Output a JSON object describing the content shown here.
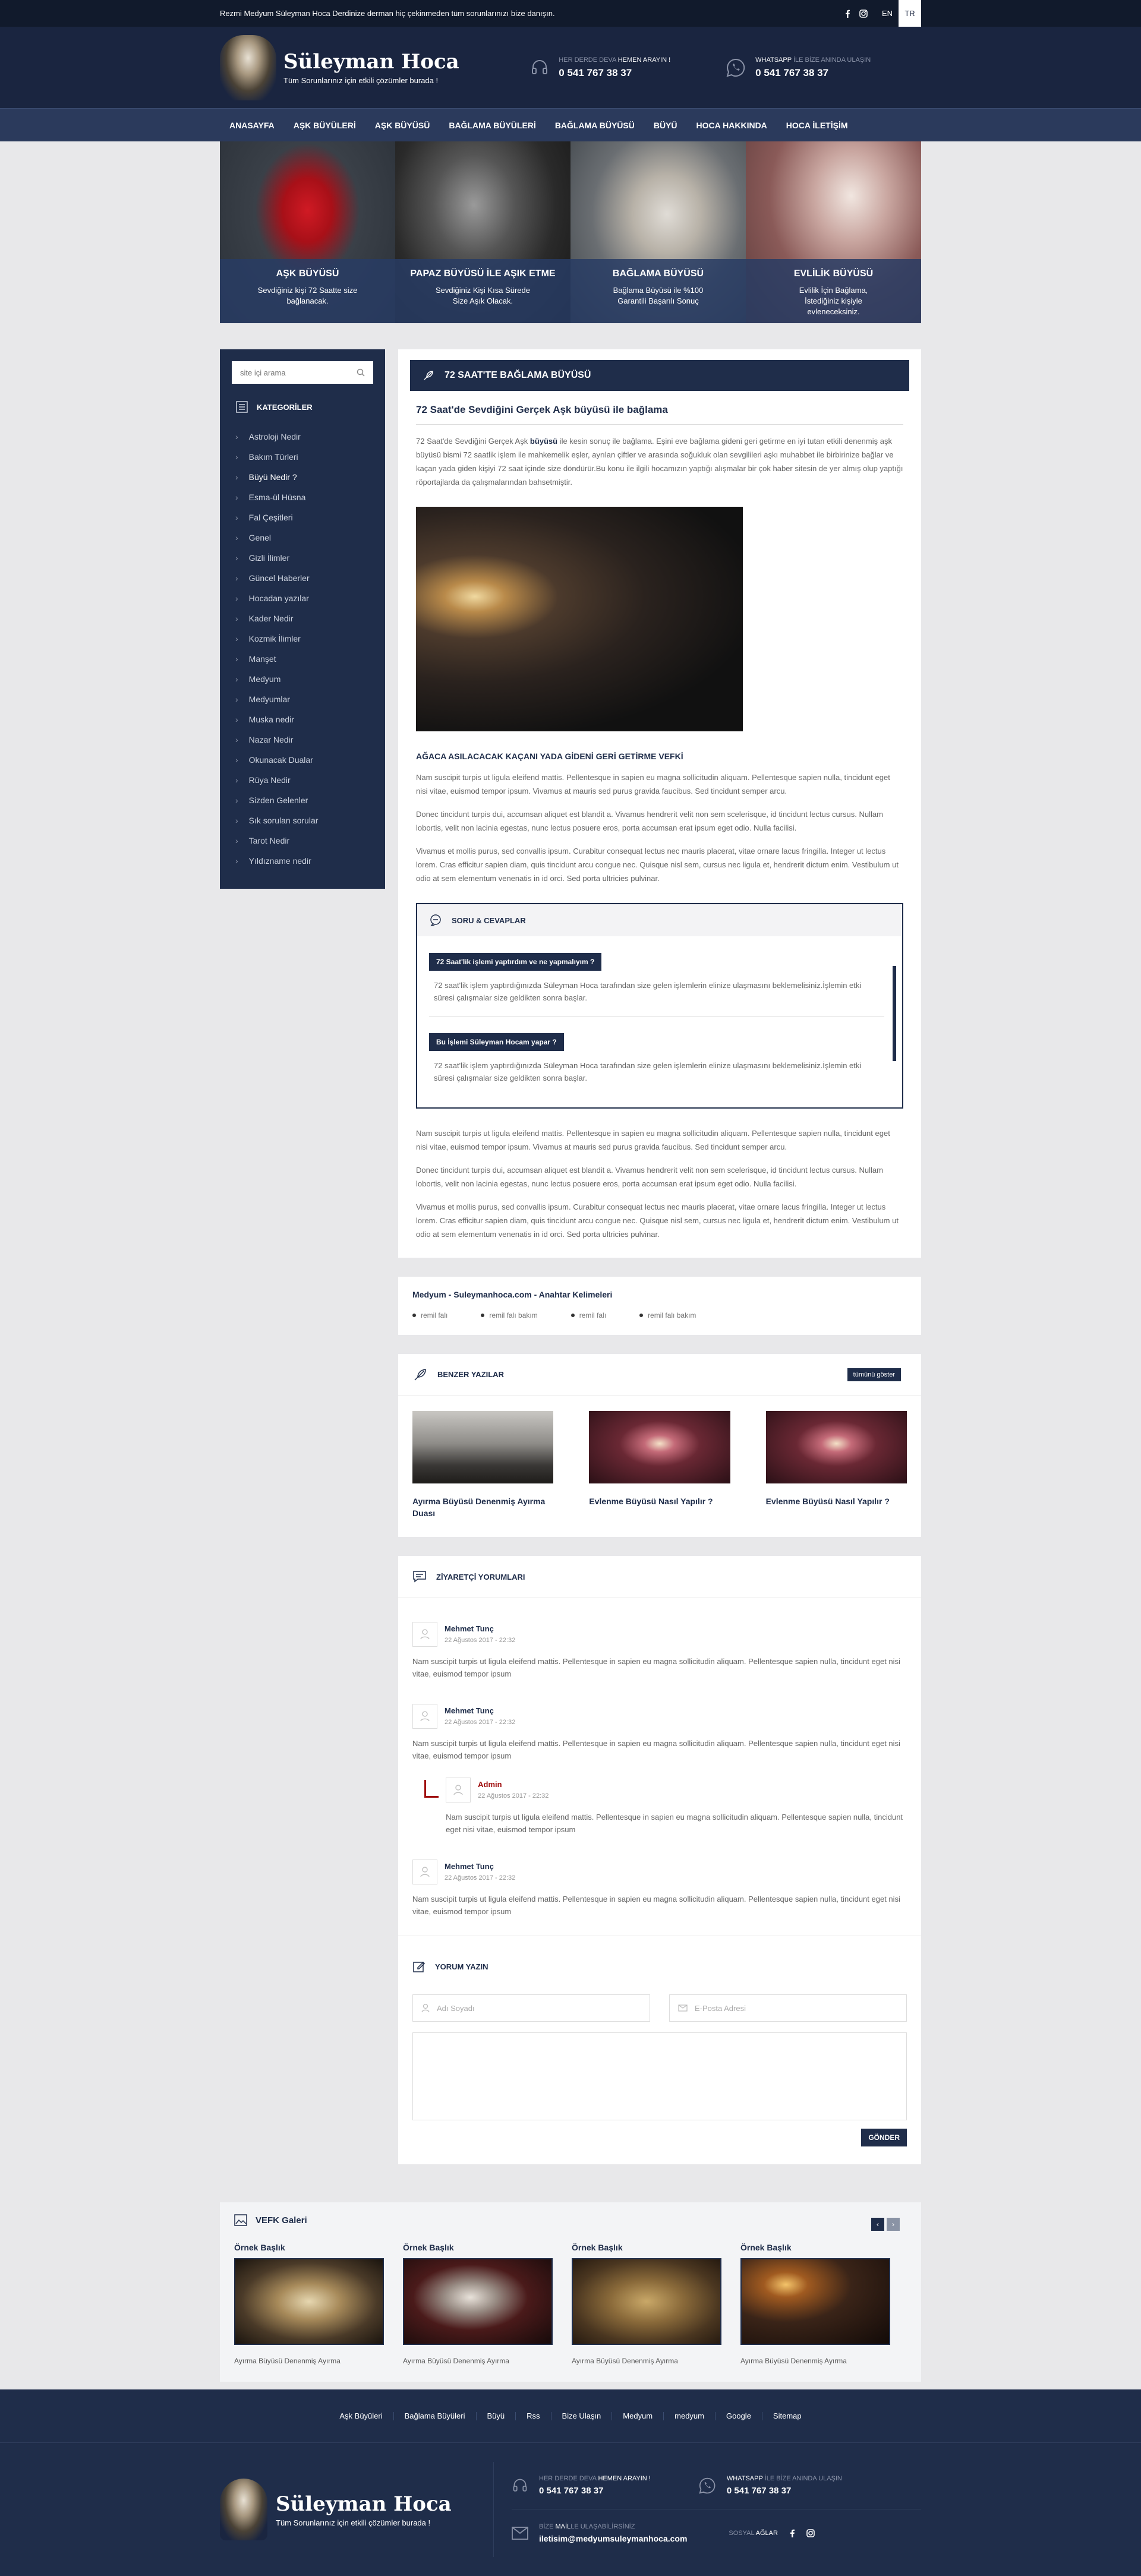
{
  "topbar": {
    "notice": "Rezmi Medyum Süleyman Hoca Derdinize derman hiç çekinmeden tüm sorunlarınızı bize danışın.",
    "lang_en": "EN",
    "lang_tr": "TR"
  },
  "header": {
    "title": "Süleyman Hoca",
    "subtitle": "Tüm Sorunlarınız için etkili çözümler burada !",
    "phone_label_a": "HER DERDE DEVA ",
    "phone_label_b": "HEMEN ARAYIN !",
    "phone": "0 541 767 38 37",
    "wa_label_a": "WHATSAPP ",
    "wa_label_b": "İLE BİZE ANINDA ULAŞIN",
    "wa_phone": "0 541 767 38 37"
  },
  "nav": [
    "ANASAYFA",
    "AŞK BÜYÜLERİ",
    "AŞK BÜYÜSÜ",
    "BAĞLAMA BÜYÜLERİ",
    "BAĞLAMA BÜYÜSÜ",
    "BÜYÜ",
    "HOCA HAKKINDA",
    "HOCA İLETİŞİM"
  ],
  "hero": [
    {
      "title": "AŞK BÜYÜSÜ",
      "text": "Sevdiğiniz kişi 72 Saatte size bağlanacak."
    },
    {
      "title": "PAPAZ BÜYÜSÜ İLE AŞIK ETME",
      "text": "Sevdiğiniz Kişi Kısa Sürede Size Aşık Olacak."
    },
    {
      "title": "BAĞLAMA BÜYÜSÜ",
      "text": "Bağlama Büyüsü ile %100 Garantili Başarılı Sonuç"
    },
    {
      "title": "EVLİLİK BÜYÜSÜ",
      "text": "Evlilik İçin Bağlama, İstediğiniz kişiyle evleneceksiniz."
    }
  ],
  "sidebar": {
    "search_placeholder": "site içi arama",
    "categories_title": "KATEGORİLER",
    "categories": [
      "Astroloji Nedir",
      "Bakım Türleri",
      "Büyü Nedir ?",
      "Esma-ül Hüsna",
      "Fal Çeşitleri",
      "Genel",
      "Gizli İlimler",
      "Güncel Haberler",
      "Hocadan yazılar",
      "Kader Nedir",
      "Kozmik İlimler",
      "Manşet",
      "Medyum",
      "Medyumlar",
      "Muska nedir",
      "Nazar Nedir",
      "Okunacak Dualar",
      "Rüya Nedir",
      "Sizden Gelenler",
      "Sık sorulan sorular",
      "Tarot Nedir",
      "Yıldızname nedir"
    ]
  },
  "post": {
    "bar_title": "72 SAAT'TE BAĞLAMA BÜYÜSÜ",
    "title": "72 Saat'de Sevdiğini Gerçek Aşk büyüsü ile bağlama",
    "p1_a": "72 Saat'de Sevdiğini Gerçek Aşk ",
    "p1_b": "büyüsü",
    "p1_c": " ile kesin sonuç ile bağlama. Eşini eve bağlama gideni geri getirme en iyi tutan etkili denenmiş aşk büyüsü bismi 72 saatlik işlem ile mahkemelik eşler, ayrılan çiftler ve arasında soğukluk olan sevgilileri aşkı muhabbet ile birbirinize bağlar ve kaçan yada giden kişiyi 72 saat içinde size döndürür.Bu konu ile ilgili hocamızın yaptığı alışmalar bir çok haber sitesin de yer almış olup yaptığı röportajlarda da çalışmalarından bahsetmiştir.",
    "subhead": "AĞACA ASILACACAK KAÇANI YADA GİDENİ GERİ GETİRME VEFKİ",
    "lorem1": "Nam suscipit turpis ut ligula eleifend mattis. Pellentesque in sapien eu magna sollicitudin aliquam. Pellentesque sapien nulla, tincidunt eget nisi vitae, euismod tempor ipsum. Vivamus at mauris sed purus gravida faucibus. Sed tincidunt semper arcu.",
    "lorem2": "Donec tincidunt turpis dui, accumsan aliquet est blandit a. Vivamus hendrerit velit non sem scelerisque, id tincidunt lectus cursus. Nullam lobortis, velit non lacinia egestas, nunc lectus posuere eros, porta accumsan erat ipsum eget odio. Nulla facilisi.",
    "lorem3": "Vivamus et mollis purus, sed convallis ipsum. Curabitur consequat lectus nec mauris placerat, vitae ornare lacus fringilla. Integer ut lectus lorem. Cras efficitur sapien diam, quis tincidunt arcu congue nec. Quisque nisl sem, cursus nec ligula et, hendrerit dictum enim. Vestibulum ut odio at sem elementum venenatis in id orci. Sed porta ultricies pulvinar."
  },
  "faq": {
    "title": "SORU & CEVAPLAR",
    "q1": "72 Saat'lik işlemi yaptırdım ve ne yapmalıyım ?",
    "a1": "72 saat'lik işlem yaptırdığınızda Süleyman Hoca tarafından size gelen işlemlerin elinize ulaşmasını beklemelisiniz.İşlemin etki süresi çalışmalar size geldikten sonra başlar.",
    "q2": "Bu İşlemi Süleyman Hocam yapar ?",
    "a2": "72 saat'lik işlem yaptırdığınızda Süleyman Hoca tarafından size gelen işlemlerin elinize ulaşmasını beklemelisiniz.İşlemin etki süresi çalışmalar size geldikten sonra başlar."
  },
  "keywords": {
    "title": "Medyum - Suleymanhoca.com - Anahtar Kelimeleri",
    "items": [
      "remil falı",
      "remil falı bakım",
      "remil falı",
      "remil falı bakım"
    ]
  },
  "related": {
    "title": "BENZER YAZILAR",
    "button": "tümünü göster",
    "items": [
      "Ayırma Büyüsü Denenmiş Ayırma Duası",
      "Evlenme Büyüsü Nasıl Yapılır ?",
      "Evlenme Büyüsü Nasıl Yapılır ?"
    ]
  },
  "comments": {
    "title": "ZİYARETÇİ YORUMLARI",
    "items": [
      {
        "name": "Mehmet Tunç",
        "date": "22 Ağustos 2017 - 22:32",
        "text": "Nam suscipit turpis ut ligula eleifend mattis. Pellentesque in sapien eu magna sollicitudin aliquam. Pellentesque sapien nulla, tincidunt eget nisi vitae, euismod tempor ipsum"
      },
      {
        "name": "Mehmet Tunç",
        "date": "22 Ağustos 2017 - 22:32",
        "text": "Nam suscipit turpis ut ligula eleifend mattis. Pellentesque in sapien eu magna sollicitudin aliquam. Pellentesque sapien nulla, tincidunt eget nisi vitae, euismod tempor ipsum"
      },
      {
        "name": "Mehmet Tunç",
        "date": "22 Ağustos 2017 - 22:32",
        "text": "Nam suscipit turpis ut ligula eleifend mattis. Pellentesque in sapien eu magna sollicitudin aliquam. Pellentesque sapien nulla, tincidunt eget nisi vitae, euismod tempor ipsum"
      }
    ],
    "reply": {
      "name": "Admin",
      "date": "22 Ağustos 2017 - 22:32",
      "text": "Nam suscipit turpis ut ligula eleifend mattis. Pellentesque in sapien eu magna sollicitudin aliquam. Pellentesque sapien nulla, tincidunt eget nisi vitae, euismod tempor ipsum"
    }
  },
  "form": {
    "title": "YORUM YAZIN",
    "name_placeholder": "Adı Soyadı",
    "email_placeholder": "E-Posta Adresi",
    "submit": "GÖNDER"
  },
  "gallery": {
    "title": "VEFK Galeri",
    "prev": "‹",
    "next": "›",
    "items": [
      {
        "title": "Örnek Başlık",
        "caption": "Ayırma Büyüsü Denenmiş Ayırma"
      },
      {
        "title": "Örnek Başlık",
        "caption": "Ayırma Büyüsü Denenmiş Ayırma"
      },
      {
        "title": "Örnek Başlık",
        "caption": "Ayırma Büyüsü Denenmiş Ayırma"
      },
      {
        "title": "Örnek Başlık",
        "caption": "Ayırma Büyüsü Denenmiş Ayırma"
      }
    ]
  },
  "footer": {
    "links": [
      "Aşk Büyüleri",
      "Bağlama Büyüleri",
      "Büyü",
      "Rss",
      "Bize Ulaşın",
      "Medyum",
      "medyum",
      "Google",
      "Sitemap"
    ],
    "title": "Süleyman Hoca",
    "subtitle": "Tüm Sorunlarınız için etkili çözümler burada !",
    "phone_label_a": "HER DERDE DEVA ",
    "phone_label_b": "HEMEN ARAYIN !",
    "phone": "0 541 767 38 37",
    "wa_label_a": "WHATSAPP ",
    "wa_label_b": "İLE BİZE ANINDA ULAŞIN",
    "wa_phone": "0 541 767 38 37",
    "mail_label_a": "BİZE ",
    "mail_label_b": "MAİL",
    "mail_label_c": "LE ULAŞABİLİRSİNİZ",
    "email": "iletisim@medyumsuleymanhoca.com",
    "social_a": "SOSYAL ",
    "social_b": "AĞLAR"
  },
  "colors": {
    "navy": "#1f2d4a",
    "header": "#1a2540",
    "accent_red": "#a01010"
  },
  "icons": [
    "facebook-icon",
    "instagram-icon",
    "headset-icon",
    "whatsapp-icon",
    "search-icon",
    "list-icon",
    "chevron-right-icon",
    "feather-icon",
    "chat-icon",
    "edit-icon",
    "user-icon",
    "mail-icon",
    "image-icon"
  ]
}
